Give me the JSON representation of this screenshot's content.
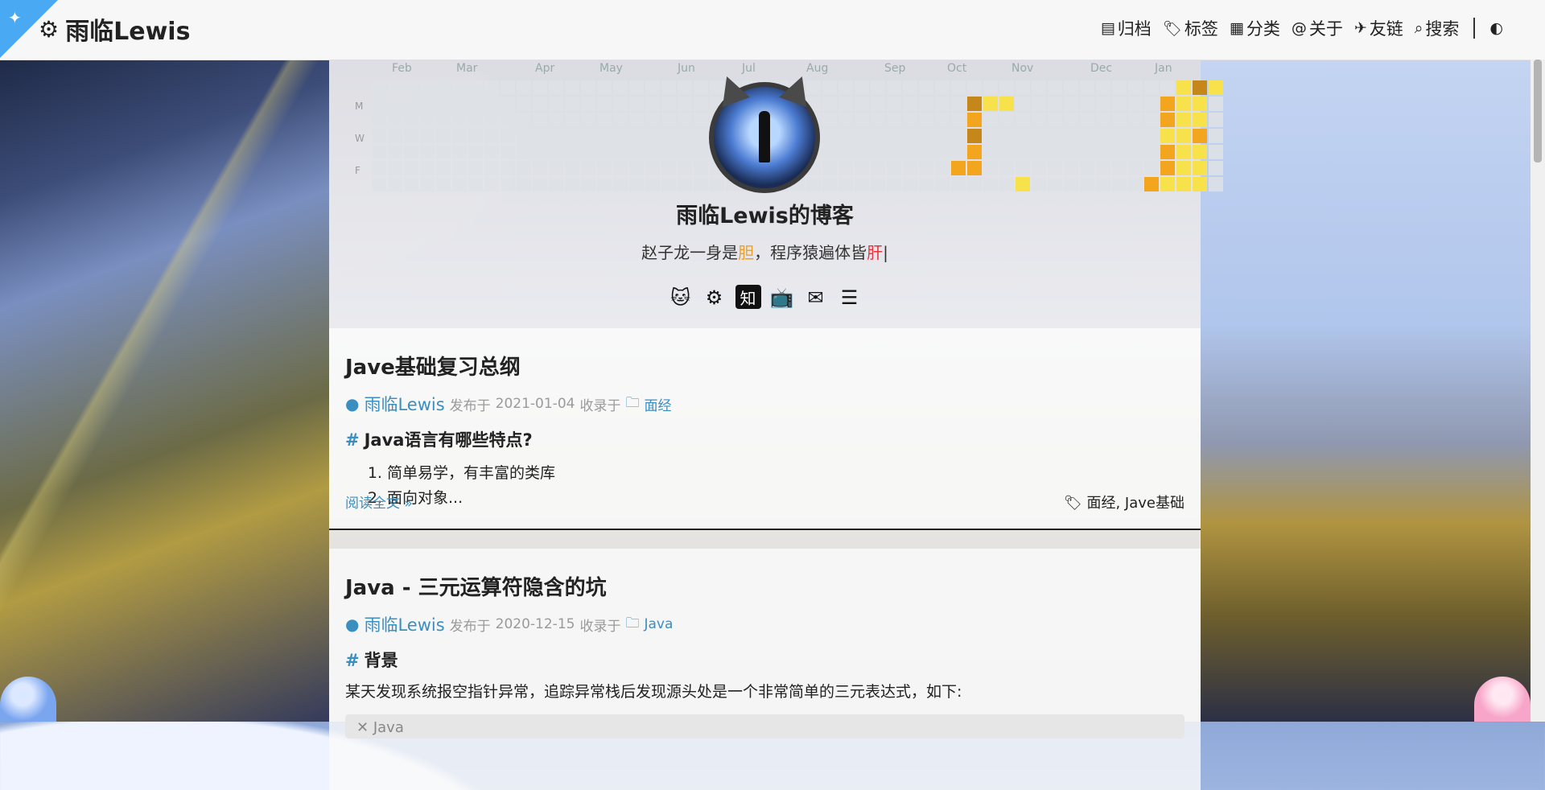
{
  "nav": {
    "brand": "雨临Lewis",
    "items": [
      {
        "icon": "archive-icon",
        "glyph": "▤",
        "label": "归档"
      },
      {
        "icon": "tag-icon",
        "glyph": "🏷",
        "label": "标签"
      },
      {
        "icon": "grid-icon",
        "glyph": "▦",
        "label": "分类"
      },
      {
        "icon": "at-icon",
        "glyph": "@",
        "label": "关于"
      },
      {
        "icon": "link-icon",
        "glyph": "✈",
        "label": "友链"
      },
      {
        "icon": "search-icon",
        "glyph": "⌕",
        "label": "搜索"
      }
    ],
    "theme_toggle_icon": "half-circle-icon"
  },
  "heatmap": {
    "months": [
      "Feb",
      "Mar",
      "Apr",
      "May",
      "Jun",
      "Jul",
      "Aug",
      "Sep",
      "Oct",
      "Nov",
      "Dec",
      "Jan"
    ],
    "day_labels": [
      "M",
      "W",
      "F"
    ]
  },
  "header": {
    "title": "雨临Lewis的博客",
    "motto_prefix": "赵子龙一身是",
    "motto_hl1": "胆",
    "motto_mid": "，程序猿遍体皆",
    "motto_hl2": "肝",
    "motto_cursor": "|",
    "socials": [
      {
        "name": "github-icon",
        "glyph": "🐱"
      },
      {
        "name": "steam-icon",
        "glyph": "⚙"
      },
      {
        "name": "zhihu-icon",
        "glyph": "知"
      },
      {
        "name": "bilibili-icon",
        "glyph": "📺"
      },
      {
        "name": "email-icon",
        "glyph": "✉"
      },
      {
        "name": "rss-icon",
        "glyph": "☰"
      }
    ]
  },
  "posts": [
    {
      "title": "Jave基础复习总纲",
      "author": "雨临Lewis",
      "published_prefix": "发布于",
      "date": "2021-01-04",
      "collected_prefix": "收录于",
      "category": "面经",
      "heading": "Java语言有哪些特点?",
      "list": [
        "简单易学，有丰富的类库",
        "面向对象..."
      ],
      "read_more": "阅读全文 »",
      "tags": "面经, Jave基础"
    },
    {
      "title": "Java - 三元运算符隐含的坑",
      "author": "雨临Lewis",
      "published_prefix": "发布于",
      "date": "2020-12-15",
      "collected_prefix": "收录于",
      "category": "Java",
      "heading": "背景",
      "paragraph": "某天发现系统报空指针异常，追踪异常栈后发现源头处是一个非常简单的三元表达式，如下:",
      "code_lang": "Java"
    }
  ]
}
